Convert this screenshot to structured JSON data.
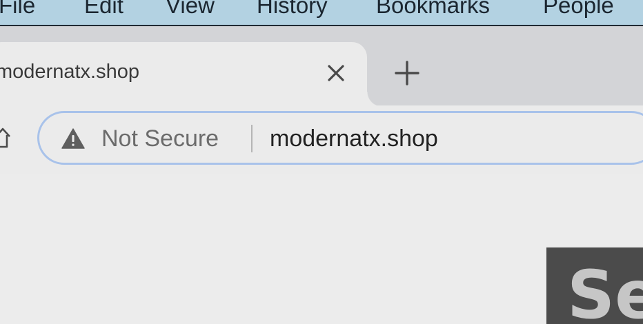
{
  "menubar": {
    "items": [
      "File",
      "Edit",
      "View",
      "History",
      "Bookmarks",
      "People"
    ]
  },
  "tab": {
    "title": "modernatx.shop",
    "close_icon": "close-icon"
  },
  "new_tab_icon": "plus-icon",
  "toolbar": {
    "home_icon": "home-icon"
  },
  "omnibox": {
    "security_icon": "warning-triangle-icon",
    "security_label": "Not Secure",
    "url": "modernatx.shop"
  },
  "content": {
    "thumbnail_text": "Se"
  },
  "colors": {
    "menubar_bg": "#b3d2e2",
    "tabstrip_bg": "#d3d4d7",
    "toolbar_bg": "#ebebeb",
    "omnibox_border": "#a8c2ea",
    "thumbnail_bg": "#4b4b4b"
  }
}
